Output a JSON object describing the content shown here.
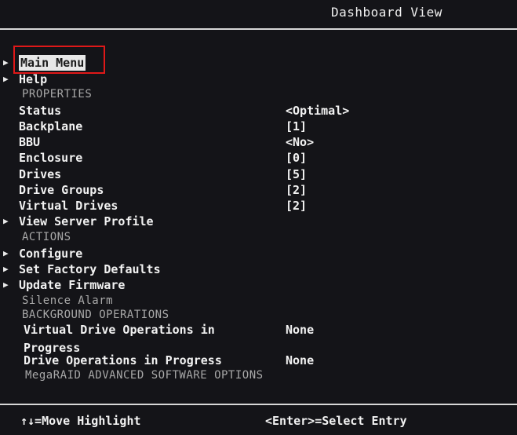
{
  "title": "Dashboard View",
  "menu": {
    "main_menu": "Main Menu",
    "help": "Help"
  },
  "properties": {
    "header": "PROPERTIES",
    "items": [
      {
        "label": "Status",
        "value": "<Optimal>"
      },
      {
        "label": "Backplane",
        "value": "[1]"
      },
      {
        "label": "BBU",
        "value": "<No>"
      },
      {
        "label": "Enclosure",
        "value": "[0]"
      },
      {
        "label": "Drives",
        "value": "[5]"
      },
      {
        "label": "Drive Groups",
        "value": "[2]"
      },
      {
        "label": "Virtual Drives",
        "value": "[2]"
      }
    ],
    "view_server_profile": "View Server Profile"
  },
  "actions": {
    "header": "ACTIONS",
    "configure": "Configure",
    "set_factory_defaults": "Set Factory Defaults",
    "update_firmware": "Update Firmware",
    "silence_alarm": "Silence Alarm"
  },
  "background_operations": {
    "header": "BACKGROUND OPERATIONS",
    "vd_ops_label_1": "Virtual Drive Operations in",
    "vd_ops_label_2": "Progress",
    "vd_ops_value": "None",
    "drive_ops_label": "Drive Operations in Progress",
    "drive_ops_value": "None"
  },
  "advanced": {
    "header": "MegaRAID ADVANCED SOFTWARE OPTIONS"
  },
  "footer": {
    "left": "↑↓=Move Highlight",
    "right": "<Enter>=Select Entry"
  },
  "colors": {
    "background": "#141418",
    "text": "#f2f2f2",
    "highlight_box": "#e01818"
  }
}
